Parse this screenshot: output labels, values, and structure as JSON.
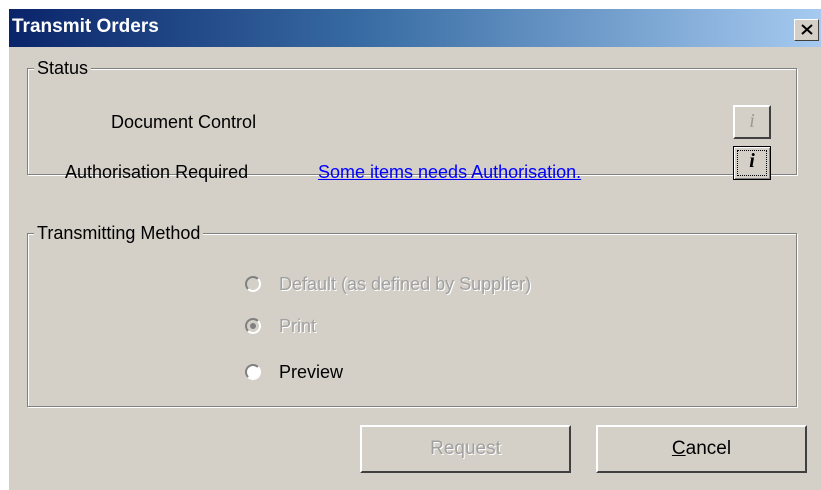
{
  "window": {
    "title": "Transmit Orders",
    "close_glyph": "close-icon"
  },
  "status_group": {
    "legend": "Status",
    "document_control_label": "Document Control",
    "authorisation_label": "Authorisation Required",
    "authorisation_link": "Some items needs Authorisation.",
    "info_button_glyph": "i"
  },
  "method_group": {
    "legend": "Transmitting Method",
    "options": [
      {
        "label": "Default (as defined by Supplier)",
        "enabled": false,
        "selected": false
      },
      {
        "label": "Print",
        "enabled": false,
        "selected": true
      },
      {
        "label": "Preview",
        "enabled": true,
        "selected": false
      }
    ]
  },
  "buttons": {
    "request_label": "Request",
    "cancel_mnemonic": "C",
    "cancel_rest": "ancel"
  },
  "colors": {
    "title_gradient_start": "#0a246a",
    "title_gradient_end": "#a6caf0",
    "link": "#0000ff",
    "dialog_face": "#d4d0c8"
  }
}
